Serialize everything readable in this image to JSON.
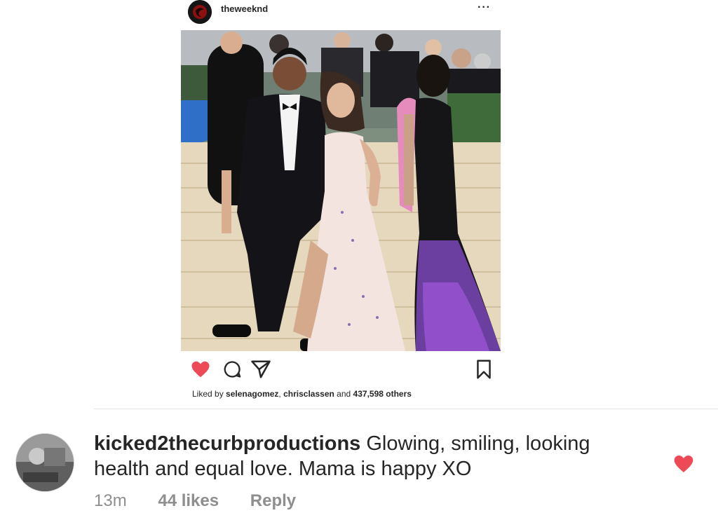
{
  "post": {
    "username": "theweeknd",
    "more_icon": "more-horizontal-icon",
    "liked": true,
    "likes_prefix": "Liked by",
    "likes_user1": "selenagomez",
    "likes_sep": ",",
    "likes_user2": "chrisclassen",
    "likes_and": "and",
    "likes_count": "437,598 others"
  },
  "actions": {
    "heart_icon": "heart-filled-icon",
    "comment_icon": "comment-icon",
    "share_icon": "send-icon",
    "save_icon": "bookmark-icon"
  },
  "comment": {
    "username": "kicked2thecurbproductions",
    "text": "Glowing, smiling, looking health and equal love. Mama is happy XO",
    "time": "13m",
    "likes": "44 likes",
    "reply": "Reply",
    "liked": true
  },
  "colors": {
    "heart": "#ed4956",
    "text": "#262626",
    "muted": "#8e8e8e"
  }
}
